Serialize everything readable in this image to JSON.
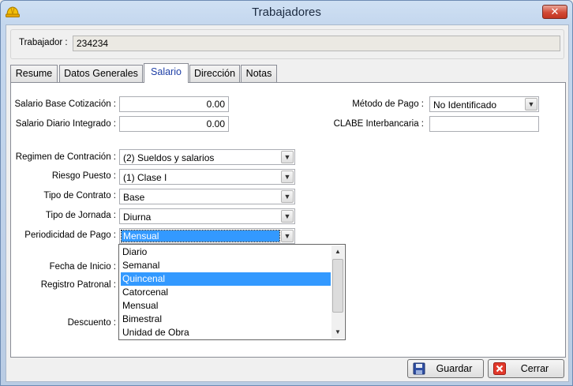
{
  "window": {
    "title": "Trabajadores",
    "close_label": "✕"
  },
  "header": {
    "trabajador_label": "Trabajador :",
    "trabajador_value": "234234"
  },
  "tabs": [
    {
      "label": "Resume"
    },
    {
      "label": "Datos Generales"
    },
    {
      "label": "Salario",
      "active": true
    },
    {
      "label": "Dirección"
    },
    {
      "label": "Notas"
    }
  ],
  "salario": {
    "base_label": "Salario Base Cotización :",
    "base_value": "0.00",
    "diario_label": "Salario Diario Integrado :",
    "diario_value": "0.00",
    "metodo_label": "Método de Pago :",
    "metodo_value": "No Identificado",
    "clabe_label": "CLABE Interbancaria :",
    "clabe_value": "",
    "regimen_label": "Regimen de Contración :",
    "regimen_value": "(2) Sueldos y salarios",
    "riesgo_label": "Riesgo Puesto :",
    "riesgo_value": "(1) Clase I",
    "contrato_label": "Tipo de Contrato :",
    "contrato_value": "Base",
    "jornada_label": "Tipo de Jornada :",
    "jornada_value": "Diurna",
    "periodicidad_label": "Periodicidad de Pago :",
    "periodicidad_value": "Mensual",
    "fecha_label": "Fecha de Inicio :",
    "registro_label": "Registro Patronal :",
    "descuento_label": "Descuento :"
  },
  "periodicidad_options": [
    "Diario",
    "Semanal",
    "Quincenal",
    "Catorcenal",
    "Mensual",
    "Bimestral",
    "Unidad de Obra"
  ],
  "periodicidad_highlighted": "Quincenal",
  "buttons": {
    "guardar": "Guardar",
    "cerrar": "Cerrar"
  },
  "colors": {
    "selection": "#3399ff",
    "active_tab_text": "#1e3fa6",
    "close_button": "#d24a36"
  },
  "icons": [
    "app-helmet-icon",
    "close-icon",
    "save-disk-icon",
    "cancel-x-icon",
    "chevron-down-icon",
    "scroll-up-icon",
    "scroll-down-icon"
  ]
}
